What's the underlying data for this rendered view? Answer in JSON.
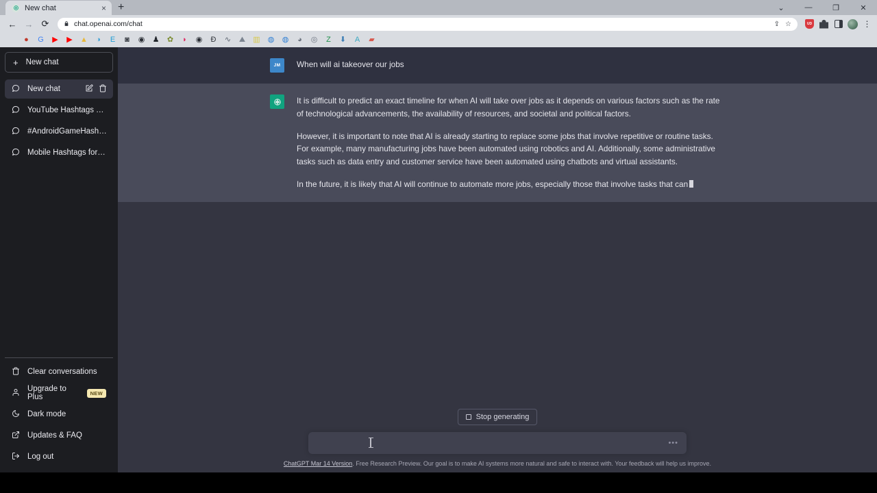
{
  "browser": {
    "tab": {
      "title": "New chat",
      "favicon": "openai-favicon",
      "close_label": "×"
    },
    "new_tab_label": "+",
    "window_controls": {
      "collapse": "⌄",
      "minimize": "—",
      "maximize": "❐",
      "close": "✕"
    },
    "nav": {
      "back": "←",
      "forward": "→",
      "reload": "⟳"
    },
    "omnibox": {
      "url": "chat.openai.com/chat",
      "lock": "🔒",
      "share": "⇪",
      "bookmark": "☆"
    },
    "extensions": [
      "brave-shields-icon",
      "puzzle-extensions-icon",
      "side-panel-icon",
      "profile-avatar",
      "chrome-menu-icon"
    ],
    "bookmarks": [
      {
        "name": "apple-bookmark",
        "glyph": "",
        "color": "#6b6f76"
      },
      {
        "name": "tomato-bookmark",
        "glyph": "●",
        "color": "#c0392b"
      },
      {
        "name": "google-bookmark",
        "glyph": "G",
        "color": "#4285f4"
      },
      {
        "name": "youtube-bookmark",
        "glyph": "▶",
        "color": "#ff0000"
      },
      {
        "name": "youtube-studio-bookmark",
        "glyph": "▶",
        "color": "#ff0000"
      },
      {
        "name": "triangle-bookmark",
        "glyph": "▲",
        "color": "#e8b93a"
      },
      {
        "name": "cloud-bookmark",
        "glyph": "◑",
        "color": "#3b9fd4"
      },
      {
        "name": "excel-bookmark",
        "glyph": "E",
        "color": "#1e9ed6"
      },
      {
        "name": "camera-bookmark",
        "glyph": "◙",
        "color": "#3c4047"
      },
      {
        "name": "globe-dark-bookmark",
        "glyph": "◉",
        "color": "#2a2e35"
      },
      {
        "name": "pin-bookmark",
        "glyph": "♟",
        "color": "#22262c"
      },
      {
        "name": "gear-green-bookmark",
        "glyph": "✿",
        "color": "#7a8b2e"
      },
      {
        "name": "flame-bookmark",
        "glyph": "◗",
        "color": "#e0245e"
      },
      {
        "name": "globe-bookmark",
        "glyph": "◉",
        "color": "#2a2e35"
      },
      {
        "name": "currency-bookmark",
        "glyph": "Ɖ",
        "color": "#2e3238"
      },
      {
        "name": "chart-bookmark",
        "glyph": "∿",
        "color": "#5b6470"
      },
      {
        "name": "mountain-bookmark",
        "glyph": "⛰",
        "color": "#7b8490"
      },
      {
        "name": "note-bookmark",
        "glyph": "▥",
        "color": "#d8c84a"
      },
      {
        "name": "oval-blue-bookmark",
        "glyph": "◍",
        "color": "#2f7fd4"
      },
      {
        "name": "oval-blue2-bookmark",
        "glyph": "◍",
        "color": "#2f7fd4"
      },
      {
        "name": "sphere-bookmark",
        "glyph": "◕",
        "color": "#6d7480"
      },
      {
        "name": "saturn-bookmark",
        "glyph": "◎",
        "color": "#6d7480"
      },
      {
        "name": "zotero-bookmark",
        "glyph": "Z",
        "color": "#1f8f4a"
      },
      {
        "name": "download-bookmark",
        "glyph": "⬇",
        "color": "#3f7fb5"
      },
      {
        "name": "aseprite-bookmark",
        "glyph": "A",
        "color": "#3aa8c1"
      },
      {
        "name": "stats-bookmark",
        "glyph": "▰",
        "color": "#d8594e"
      }
    ]
  },
  "sidebar": {
    "new_chat": {
      "label": "New chat",
      "icon": "plus-icon"
    },
    "conversations": [
      {
        "label": "New chat",
        "icon": "chat-bubble-icon",
        "active": true,
        "edit_icon": "pencil-icon",
        "delete_icon": "trash-icon"
      },
      {
        "label": "YouTube Hashtags Tips",
        "icon": "chat-bubble-icon",
        "active": false
      },
      {
        "label": "#AndroidGameHashtags",
        "icon": "chat-bubble-icon",
        "active": false
      },
      {
        "label": "Mobile Hashtags for Twitter",
        "icon": "chat-bubble-icon",
        "active": false
      }
    ],
    "bottom_items": [
      {
        "label": "Clear conversations",
        "icon": "trash-icon",
        "badge": null
      },
      {
        "label": "Upgrade to Plus",
        "icon": "person-icon",
        "badge": "NEW"
      },
      {
        "label": "Dark mode",
        "icon": "moon-icon",
        "badge": null
      },
      {
        "label": "Updates & FAQ",
        "icon": "external-link-icon",
        "badge": null
      },
      {
        "label": "Log out",
        "icon": "logout-icon",
        "badge": null
      }
    ]
  },
  "conversation": {
    "messages": [
      {
        "role": "user",
        "avatar_initials": "JM",
        "paragraphs": [
          "When will ai takeover our jobs"
        ]
      },
      {
        "role": "assistant",
        "avatar_icon": "openai-logo",
        "paragraphs": [
          "It is difficult to predict an exact timeline for when AI will take over jobs as it depends on various factors such as the rate of technological advancements, the availability of resources, and societal and political factors.",
          "However, it is important to note that AI is already starting to replace some jobs that involve repetitive or routine tasks. For example, many manufacturing jobs have been automated using robotics and AI. Additionally, some administrative tasks such as data entry and customer service have been automated using chatbots and virtual assistants.",
          "In the future, it is likely that AI will continue to automate more jobs, especially those that involve tasks that can"
        ],
        "streaming": true
      }
    ]
  },
  "composer": {
    "stop_button": {
      "label": "Stop generating",
      "icon": "stop-square-icon"
    },
    "input_value": "",
    "input_placeholder": "",
    "dots_icon": "…"
  },
  "footer": {
    "link_text": "ChatGPT Mar 14 Version",
    "rest_text": ". Free Research Preview. Our goal is to make AI systems more natural and safe to interact with. Your feedback will help us improve."
  },
  "colors": {
    "sidebar_bg": "#1c1d21",
    "user_msg_bg": "#2f3140",
    "assistant_msg_bg": "#494b5a",
    "page_bg": "#343541",
    "accent_green": "#10a37f",
    "avatar_blue": "#3d87c9",
    "badge_yellow": "#f5e8b0"
  }
}
